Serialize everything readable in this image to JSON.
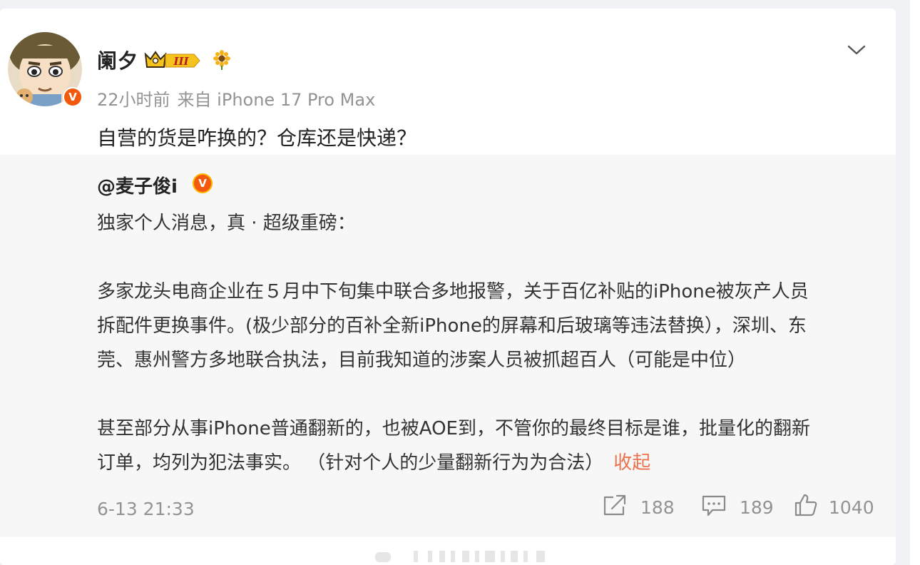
{
  "post": {
    "username": "阑夕",
    "member_level": "III",
    "verified_mark": "V",
    "time": "22小时前",
    "source": "来自 iPhone 17 Pro Max",
    "text": "自营的货是咋换的？仓库还是快递？"
  },
  "repost": {
    "author": "@麦子俊i",
    "verified_mark": "V",
    "paragraphs": [
      [
        "独家个人消息，真 · 超级重磅："
      ],
      [
        "多家龙头电商企业在５月中下旬集中联合多地报警，关于百亿补贴的iPhone被灰产人员",
        "拆配件更换事件。(极少部分的百补全新iPhone的屏幕和后玻璃等违法替换），深圳、东",
        "莞、惠州警方多地联合执法，目前我知道的涉案人员被抓超百人（可能是中位）"
      ],
      [
        "甚至部分从事iPhone普通翻新的，也被AOE到，不管你的最终目标是谁，批量化的翻新",
        "订单，均列为犯法事实。 （针对个人的少量翻新行为为合法）"
      ]
    ],
    "collapse_label": "收起",
    "timestamp": "6-13 21:33",
    "share_count": "188",
    "comment_count": "189",
    "like_count": "1040"
  },
  "icons": {
    "menu": "chevron-down-icon",
    "share": "share-icon",
    "comment": "comment-icon",
    "like": "thumbs-up-icon",
    "badge": "crown-icon",
    "flower": "sunflower-icon"
  },
  "colors": {
    "accent_link": "#eb7350",
    "verified": "#f2590c",
    "muted": "#939393"
  }
}
